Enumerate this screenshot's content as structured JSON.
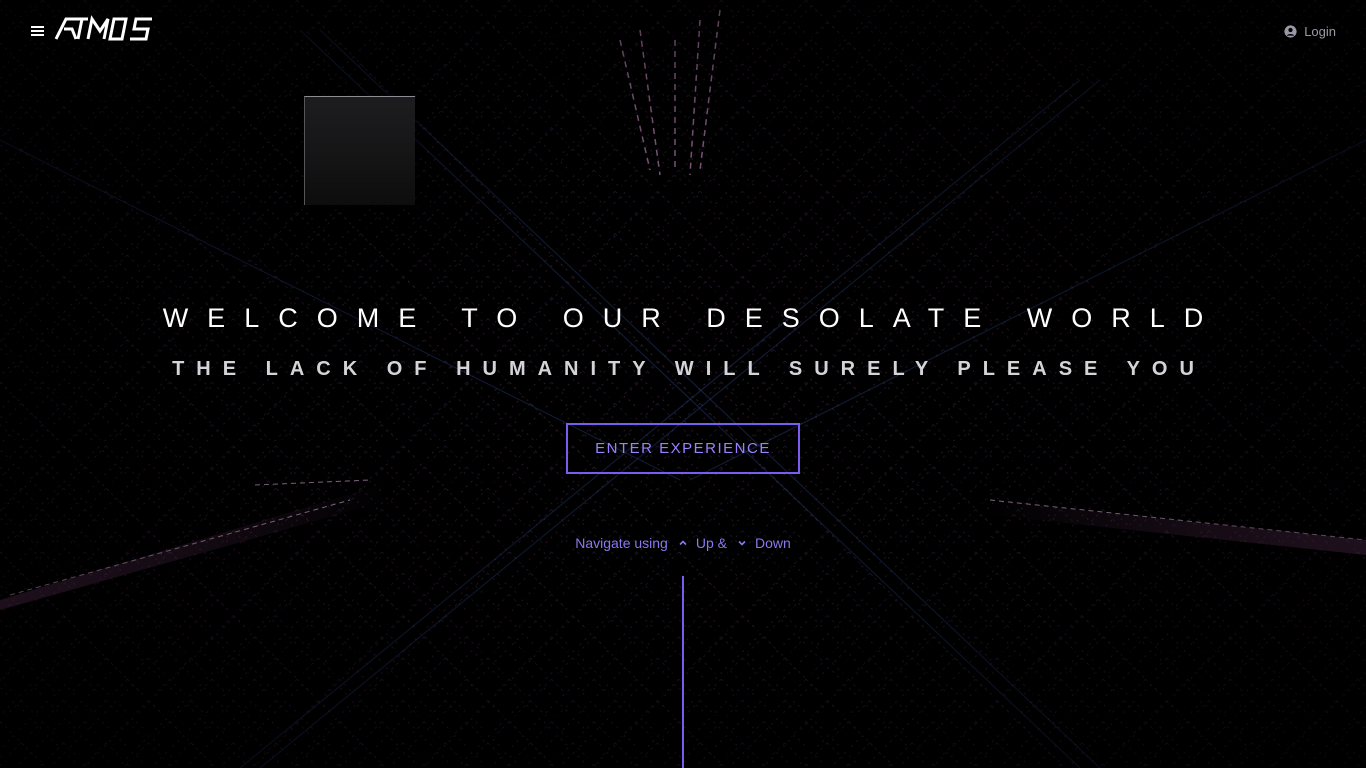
{
  "header": {
    "menu_icon": "hamburger-menu-icon",
    "logo_text": "ATMOS",
    "login_label": "Login",
    "login_icon": "user-circle-icon"
  },
  "hero": {
    "title": "WELCOME TO OUR DESOLATE WORLD",
    "subtitle": "THE LACK OF HUMANITY WILL SURELY PLEASE YOU",
    "cta_label": "ENTER EXPERIENCE"
  },
  "navigation_hint": {
    "prefix": "Navigate using",
    "up_icon": "chevron-up-icon",
    "up_label": "Up &",
    "down_icon": "chevron-down-icon",
    "down_label": "Down"
  },
  "colors": {
    "background": "#000000",
    "accent": "#7a5df0",
    "accent_text": "#9a82ff",
    "text": "#ffffff",
    "muted": "#9a9aa6"
  }
}
